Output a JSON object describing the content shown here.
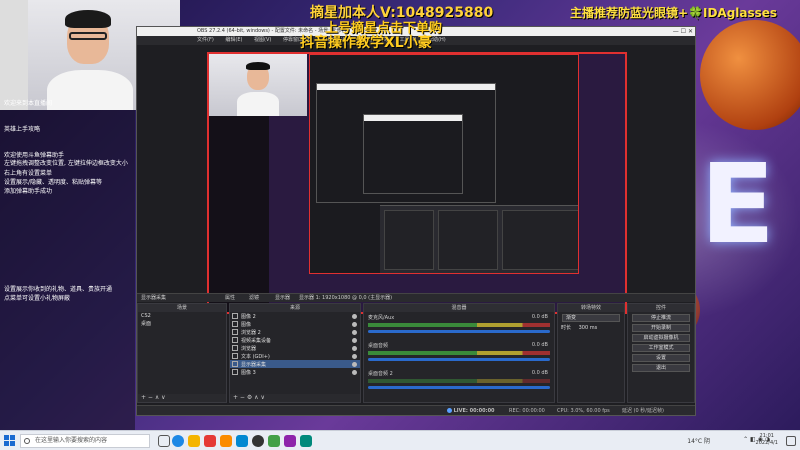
{
  "overlay": {
    "line1": "摘星加本人V:1048925880",
    "line2": "上号摘星点击下单购",
    "line3": "抖音操作教学XL小豪",
    "promo": "主播推荐防蓝光眼镜+🍀IDAglasses"
  },
  "chat": {
    "header": "欢迎来到本直播间",
    "lines": [
      "英雄上手攻略",
      "欢迎使用斗鱼弹幕助手",
      "左键拖拽调整改变位置, 左键拉伸边框改变大小",
      "右上角有设置菜单",
      "设置展示/隐藏、透明度、粘贴弹幕等",
      "添加弹幕助手成功",
      "设置展示你收到的礼物、道具、贵族开通",
      "点菜单可设置小礼物屏蔽"
    ]
  },
  "obs": {
    "title": "OBS 27.2.4 (64-bit, windows) - 配置文件: 未命名 - 场景: 未命名",
    "menu": [
      "文件(F)",
      "编辑(E)",
      "视图(V)",
      "停靠窗口(D)",
      "配置文件(P)",
      "场景集合(S)",
      "工具(T)",
      "帮助(H)"
    ],
    "toolbar": {
      "source_label": "显示器采集",
      "properties": "属性",
      "filters": "滤镜",
      "display_label": "显示器",
      "display_value": "显示器 1: 1920x1080 @ 0,0 (主显示器)"
    },
    "scenes": {
      "title": "场景",
      "items": [
        "CS2",
        "桌面"
      ]
    },
    "sources": {
      "title": "来源",
      "items": [
        "图像 2",
        "图像",
        "浏览器 2",
        "视频采集设备",
        "浏览器",
        "文本 (GDI+)",
        "显示器采集",
        "图像 3"
      ]
    },
    "mixer": {
      "title": "混音器",
      "channels": [
        {
          "name": "麦克风/Aux",
          "db": "0.0 dB"
        },
        {
          "name": "桌面音频",
          "db": "0.0 dB"
        },
        {
          "name": "桌面音频 2",
          "db": "0.0 dB"
        }
      ]
    },
    "transitions": {
      "title": "转场特效",
      "type": "渐变",
      "duration_label": "时长",
      "duration_value": "300 ms"
    },
    "controls": {
      "title": "控件",
      "buttons": [
        "停止推流",
        "开始录制",
        "启动虚拟摄像机",
        "工作室模式",
        "设置",
        "退出"
      ]
    },
    "status": {
      "live": "LIVE: 00:00:00",
      "rec": "REC: 00:00:00",
      "cpu": "CPU: 3.0%, 60.00 fps",
      "dropped": "延迟 (0 秒/延迟帧)"
    }
  },
  "taskbar": {
    "search_placeholder": "在这里输入你要搜索的内容",
    "weather": "14°C 阴",
    "time": "21:01",
    "date": "2022/4/1"
  },
  "colors": {
    "accent_red": "#e03030",
    "overlay_yellow": "#ffcc20",
    "obs_bg": "#1e1e22",
    "selection_blue": "#3a5a8a"
  }
}
